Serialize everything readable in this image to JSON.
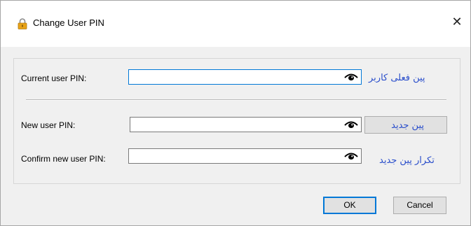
{
  "dialog": {
    "title": "Change User PIN",
    "icon": "lock-icon",
    "close_glyph": "✕"
  },
  "form": {
    "current_pin": {
      "label": "Current user PIN:",
      "value": "",
      "persian_label": "پین فعلی کاربر",
      "reveal_icon": "eye-icon"
    },
    "new_pin": {
      "label": "New user PIN:",
      "value": "",
      "persian_label": "پین جدید",
      "reveal_icon": "eye-icon"
    },
    "confirm_pin": {
      "label": "Confirm new user PIN:",
      "value": "",
      "persian_label": "تکرار پین جدید",
      "reveal_icon": "eye-icon"
    }
  },
  "buttons": {
    "ok": "OK",
    "cancel": "Cancel"
  },
  "colors": {
    "accent": "#0078d7",
    "persian_text": "#2a4ecb",
    "dialog_bg": "#f0f0f0"
  }
}
